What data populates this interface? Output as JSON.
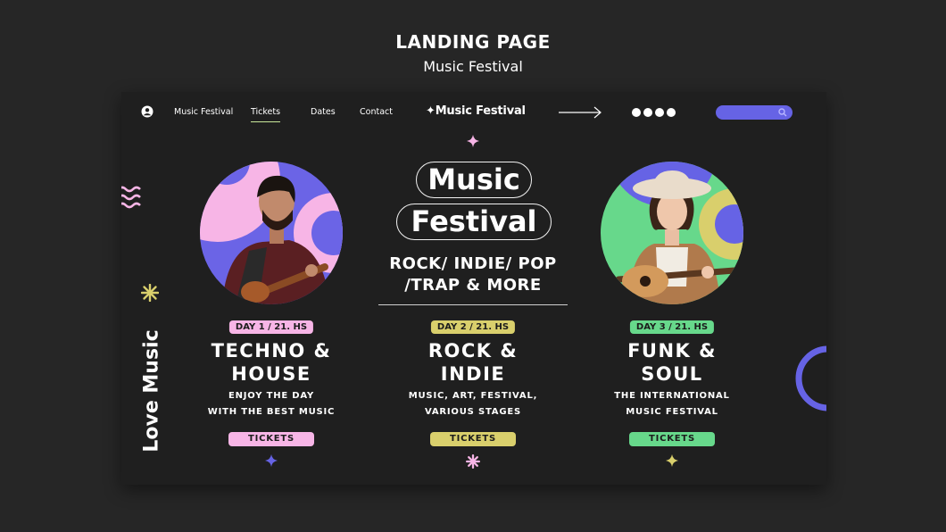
{
  "presentation": {
    "title": "LANDING PAGE",
    "subtitle": "Music Festival"
  },
  "nav": {
    "links": [
      "Music Festival",
      "Tickets",
      "Dates",
      "Contact"
    ],
    "brand": "✦Music Festival"
  },
  "side": {
    "vertical_text": "Love Music"
  },
  "hero": {
    "pill_1": "Music",
    "pill_2": "Festival",
    "genres_line_1": "ROCK/ INDIE/ POP",
    "genres_line_2": "/TRAP & MORE"
  },
  "events": [
    {
      "day": "DAY 1 / 21. HS",
      "title_1": "TECHNO &",
      "title_2": "HOUSE",
      "desc_1": "ENJOY THE DAY",
      "desc_2": "WITH THE BEST MUSIC",
      "button": "TICKETS",
      "color": "#f7b5e6"
    },
    {
      "day": "DAY 2 / 21. HS",
      "title_1": "ROCK &",
      "title_2": "INDIE",
      "desc_1": "MUSIC, ART, FESTIVAL,",
      "desc_2": "VARIOUS STAGES",
      "button": "TICKETS",
      "color": "#d9cf6c"
    },
    {
      "day": "DAY 3 / 21. HS",
      "title_1": "FUNK &",
      "title_2": "SOUL",
      "desc_1": "THE INTERNATIONAL",
      "desc_2": "MUSIC FESTIVAL",
      "button": "TICKETS",
      "color": "#67d88b"
    }
  ],
  "colors": {
    "accent_purple": "#6663e5",
    "pink": "#f7b5e6",
    "yellow": "#d9cf6c",
    "green": "#67d88b",
    "background": "#262626",
    "card": "#1f1f1f"
  }
}
